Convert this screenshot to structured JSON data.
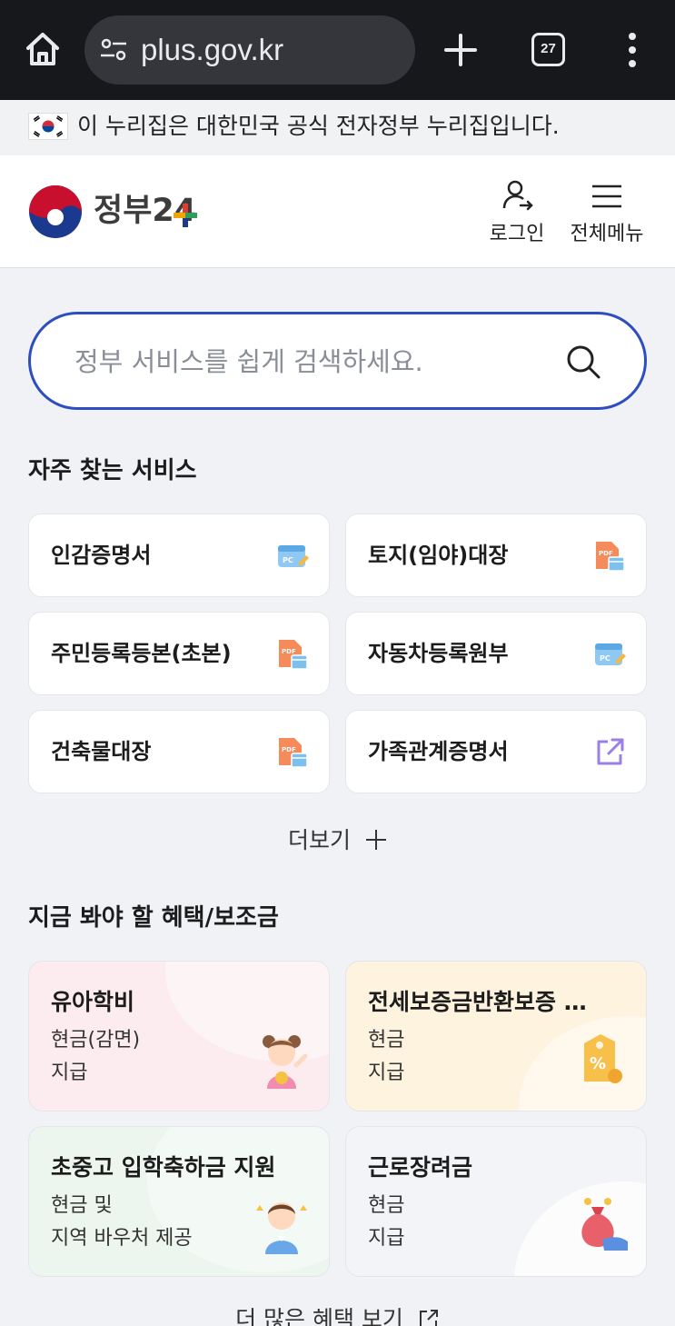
{
  "browser": {
    "url": "plus.gov.kr",
    "tab_count": "27"
  },
  "notice": {
    "text": "이 누리집은 대한민국 공식 전자정부 누리집입니다."
  },
  "header": {
    "logo_text": "정부24",
    "login_label": "로그인",
    "menu_label": "전체메뉴"
  },
  "search": {
    "placeholder": "정부 서비스를 쉽게 검색하세요."
  },
  "frequent": {
    "title": "자주 찾는 서비스",
    "items": [
      {
        "label": "인감증명서",
        "icon": "pc-icon"
      },
      {
        "label": "토지(임야)대장",
        "icon": "pdf-icon"
      },
      {
        "label": "주민등록등본(초본)",
        "icon": "pdf-icon"
      },
      {
        "label": "자동차등록원부",
        "icon": "pc-icon"
      },
      {
        "label": "건축물대장",
        "icon": "pdf-icon"
      },
      {
        "label": "가족관계증명서",
        "icon": "external-link-icon"
      }
    ],
    "more_label": "더보기"
  },
  "benefits": {
    "title": "지금 봐야 할 혜택/보조금",
    "items": [
      {
        "title": "유아학비",
        "line1": "현금(감면)",
        "line2": "지급",
        "bg": "#fcecef",
        "icon": "child-illustration-icon"
      },
      {
        "title": "전세보증금반환보증 …",
        "line1": "현금",
        "line2": "지급",
        "bg": "#fef3de",
        "icon": "discount-tag-icon"
      },
      {
        "title": "초중고 입학축하금 지원",
        "line1": "현금 및",
        "line2": "지역 바우처 제공",
        "bg": "#ecf6ee",
        "icon": "student-illustration-icon"
      },
      {
        "title": "근로장려금",
        "line1": "현금",
        "line2": "지급",
        "bg": "#f1f3f8",
        "icon": "money-bag-icon"
      }
    ],
    "more_label": "더 많은 혜택 보기"
  }
}
